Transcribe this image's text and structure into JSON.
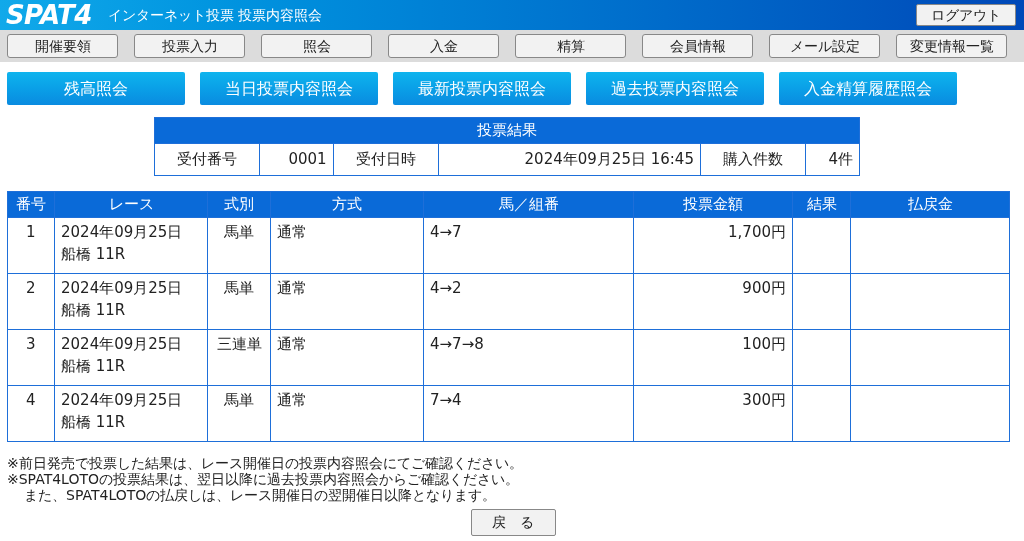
{
  "header": {
    "logo": "SPAT4",
    "title": "インターネット投票 投票内容照会",
    "logout": "ログアウト"
  },
  "nav": [
    "開催要領",
    "投票入力",
    "照会",
    "入金",
    "精算",
    "会員情報",
    "メール設定",
    "変更情報一覧"
  ],
  "subnav": [
    "残高照会",
    "当日投票内容照会",
    "最新投票内容照会",
    "過去投票内容照会",
    "入金精算履歴照会"
  ],
  "summary": {
    "title": "投票結果",
    "cells": [
      {
        "kind": "label",
        "text": "受付番号"
      },
      {
        "kind": "value",
        "text": "0001"
      },
      {
        "kind": "label",
        "text": "受付日時"
      },
      {
        "kind": "value",
        "text": "2024年09月25日 16:45"
      },
      {
        "kind": "label",
        "text": "購入件数"
      },
      {
        "kind": "value",
        "text": "4件"
      }
    ]
  },
  "table": {
    "columns": [
      "番号",
      "レース",
      "式別",
      "方式",
      "馬／組番",
      "投票金額",
      "結果",
      "払戻金"
    ],
    "rows": [
      {
        "no": "1",
        "race": [
          "2024年09月25日",
          "船橋 11R"
        ],
        "type": "馬単",
        "method": "通常",
        "combo": "4→7",
        "amount": "1,700円"
      },
      {
        "no": "2",
        "race": [
          "2024年09月25日",
          "船橋 11R"
        ],
        "type": "馬単",
        "method": "通常",
        "combo": "4→2",
        "amount": "900円"
      },
      {
        "no": "3",
        "race": [
          "2024年09月25日",
          "船橋 11R"
        ],
        "type": "三連単",
        "method": "通常",
        "combo": "4→7→8",
        "amount": "100円"
      },
      {
        "no": "4",
        "race": [
          "2024年09月25日",
          "船橋 11R"
        ],
        "type": "馬単",
        "method": "通常",
        "combo": "7→4",
        "amount": "300円"
      }
    ]
  },
  "notes": [
    {
      "kind": "note",
      "text": "※前日発売で投票した結果は、レース開催日の投票内容照会にてご確認ください。"
    },
    {
      "kind": "note",
      "text": "※SPAT4LOTOの投票結果は、翌日以降に過去投票内容照会からご確認ください。"
    },
    {
      "kind": "continuation",
      "text": "また、SPAT4LOTOの払戻しは、レース開催日の翌開催日以降となります。"
    }
  ],
  "back_button": "戻　る"
}
